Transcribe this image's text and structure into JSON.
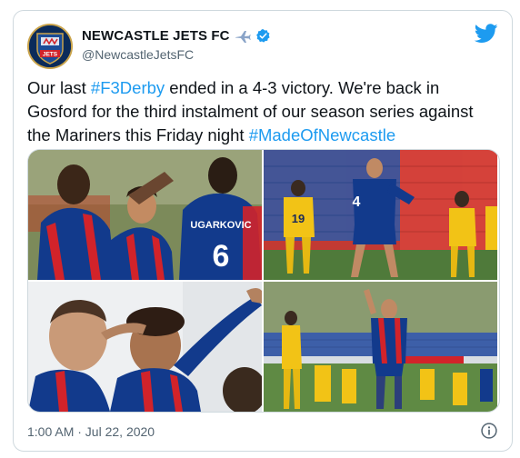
{
  "author": {
    "display_name": "NEWCASTLE JETS FC",
    "handle": "@NewcastleJetsFC",
    "avatar_text": "JETS"
  },
  "tweet": {
    "segments": [
      {
        "text": "Our last ",
        "type": "text"
      },
      {
        "text": "#F3Derby",
        "type": "hashtag"
      },
      {
        "text": " ended in a 4-3 victory. We're back in Gosford for the third instalment of our season series against the Mariners this Friday night ",
        "type": "text"
      },
      {
        "text": "#MadeOfNewcastle",
        "type": "hashtag"
      }
    ]
  },
  "photos": {
    "p1": {
      "jersey_name": "UGARKOVIC",
      "jersey_number": "6"
    },
    "p2": {
      "jersey_number": "4",
      "opponent_number": "19"
    },
    "p3": {},
    "p4": {}
  },
  "footer": {
    "timestamp": "1:00 AM · Jul 22, 2020"
  },
  "colors": {
    "accent": "#1d9bf0",
    "jets_blue": "#123a8c",
    "jets_red": "#d2232a",
    "mariners_yellow": "#f2c316"
  },
  "icons": {
    "plane": "airplane-icon",
    "verified": "verified-badge-icon",
    "brand": "twitter-bird-icon",
    "info": "info-icon"
  }
}
